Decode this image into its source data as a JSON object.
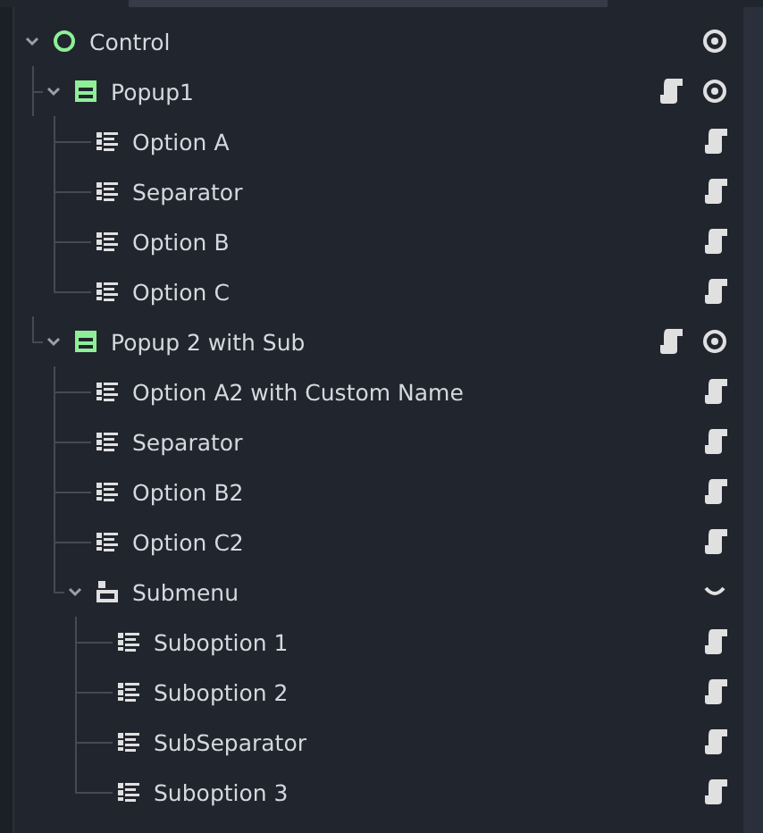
{
  "tree": [
    {
      "name": "Control",
      "kind": "control",
      "expanded": true,
      "eye": true,
      "children": [
        {
          "name": "Popup1",
          "kind": "popup",
          "expanded": true,
          "script": true,
          "eye": true,
          "children": [
            {
              "name": "Option A",
              "kind": "item",
              "script": true
            },
            {
              "name": "Separator",
              "kind": "item",
              "script": true
            },
            {
              "name": "Option B",
              "kind": "item",
              "script": true
            },
            {
              "name": "Option C",
              "kind": "item",
              "script": true
            }
          ]
        },
        {
          "name": "Popup 2 with Sub",
          "kind": "popup",
          "expanded": true,
          "script": true,
          "eye": true,
          "children": [
            {
              "name": "Option A2 with Custom Name",
              "kind": "item",
              "script": true
            },
            {
              "name": "Separator",
              "kind": "item",
              "script": true
            },
            {
              "name": "Option B2",
              "kind": "item",
              "script": true
            },
            {
              "name": "Option C2",
              "kind": "item",
              "script": true
            },
            {
              "name": "Submenu",
              "kind": "submenu",
              "expanded": true,
              "fold": true,
              "children": [
                {
                  "name": "Suboption 1",
                  "kind": "item",
                  "script": true
                },
                {
                  "name": "Suboption 2",
                  "kind": "item",
                  "script": true
                },
                {
                  "name": "SubSeparator",
                  "kind": "item",
                  "script": true
                },
                {
                  "name": "Suboption 3",
                  "kind": "item",
                  "script": true
                }
              ]
            }
          ]
        }
      ]
    }
  ]
}
